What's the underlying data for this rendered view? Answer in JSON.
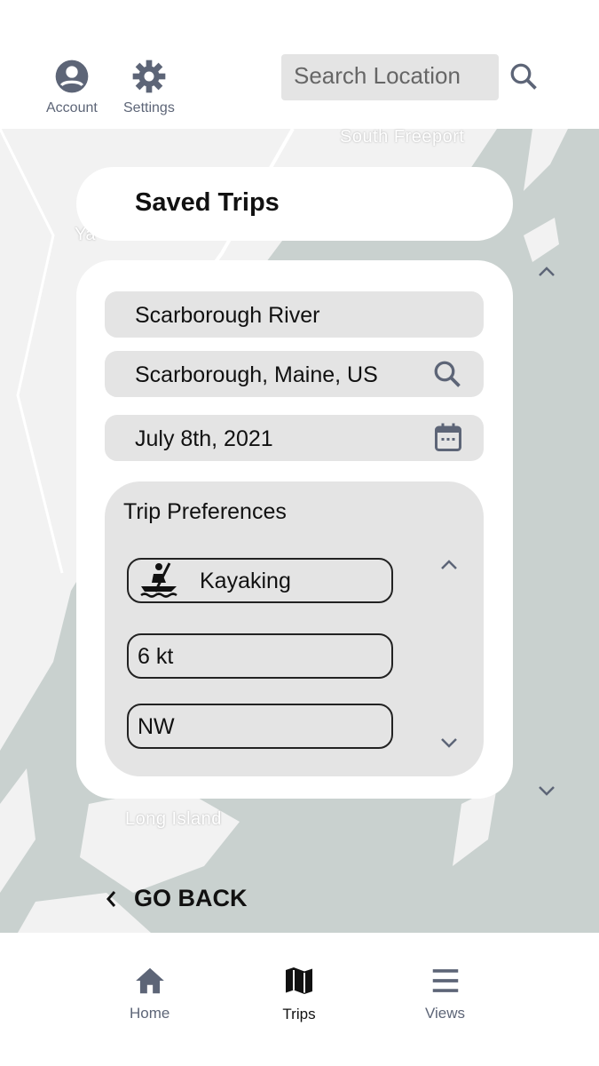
{
  "header": {
    "account_label": "Account",
    "settings_label": "Settings",
    "search_placeholder": "Search Location"
  },
  "map": {
    "labels": [
      "South Freeport",
      "Ya",
      "Long Island"
    ],
    "land_color": "#f2f2f2",
    "water_color": "#c9d1cf"
  },
  "saved_trips": {
    "title": "Saved Trips"
  },
  "trip": {
    "name": "Scarborough River",
    "location": "Scarborough, Maine, US",
    "date": "July 8th, 2021"
  },
  "preferences": {
    "title": "Trip Preferences",
    "activity": "Kayaking",
    "wind_speed": "6 kt",
    "wind_direction": "NW"
  },
  "go_back": "GO BACK",
  "bottom_nav": {
    "items": [
      {
        "label": "Home"
      },
      {
        "label": "Trips",
        "active": true
      },
      {
        "label": "Views"
      }
    ]
  },
  "colors": {
    "icon": "#5d6577",
    "field": "#e4e4e4"
  }
}
